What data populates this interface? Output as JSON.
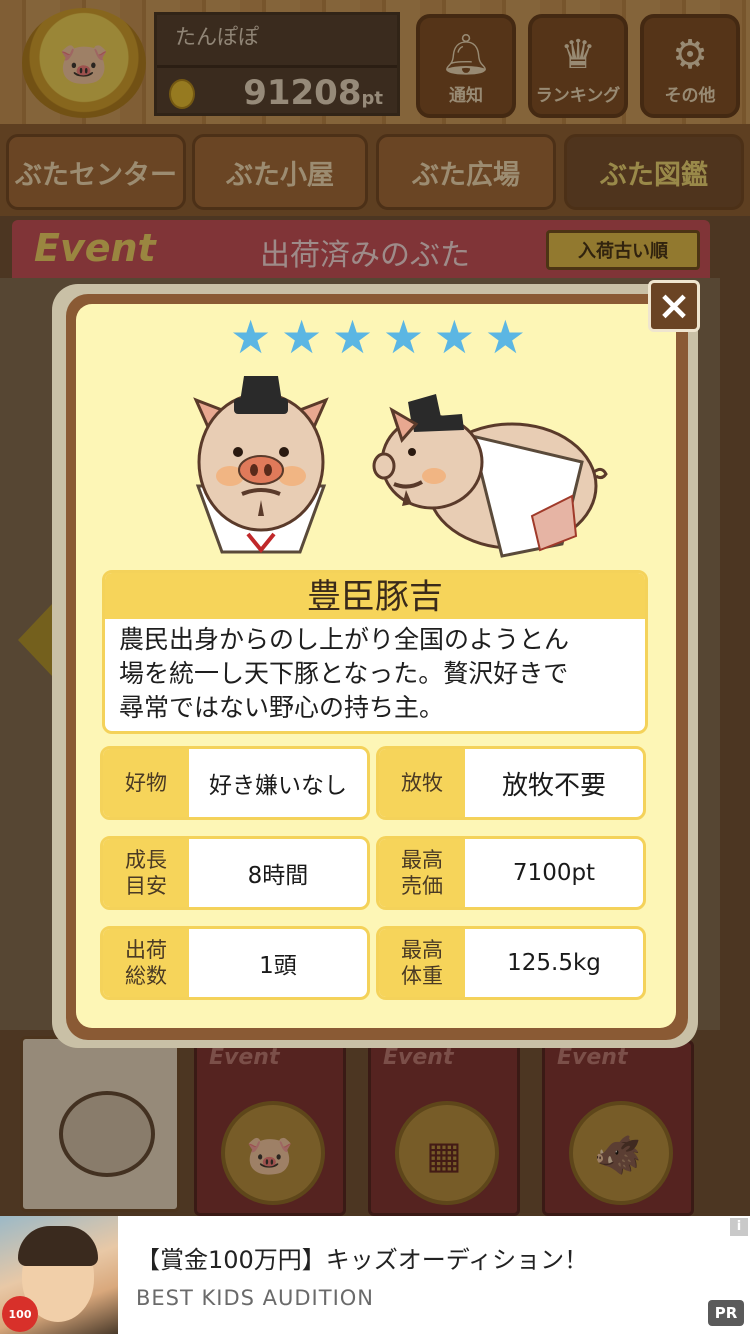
{
  "header": {
    "user_name": "たんぽぽ",
    "points": "91208",
    "points_unit": "pt",
    "buttons": [
      {
        "label": "通知",
        "icon": "bell-icon"
      },
      {
        "label": "ランキング",
        "icon": "crown-icon"
      },
      {
        "label": "その他",
        "icon": "gear-icon"
      }
    ]
  },
  "nav": {
    "tabs": [
      {
        "label": "ぶたセンター",
        "active": false
      },
      {
        "label": "ぶた小屋",
        "active": false
      },
      {
        "label": "ぶた広場",
        "active": false
      },
      {
        "label": "ぶた図鑑",
        "active": true
      }
    ]
  },
  "event_bar": {
    "badge": "Event",
    "title": "出荷済みのぶた",
    "sort_label": "入荷古い順"
  },
  "modal": {
    "close_label": "×",
    "rarity_stars": 6,
    "pig_name": "豊臣豚吉",
    "description_lines": [
      "農民出身からのし上がり全国のようとん",
      "場を統一し天下豚となった。贅沢好きで",
      "尋常ではない野心の持ち主。"
    ],
    "stats": {
      "favorite": {
        "label": "好物",
        "value": "好き嫌いなし"
      },
      "pasture": {
        "label": "放牧",
        "value": "放牧不要"
      },
      "growth": {
        "label": "成長\n目安",
        "value": "8時間"
      },
      "max_price": {
        "label": "最高\n売価",
        "value": "7100pt"
      },
      "shipped": {
        "label": "出荷\n総数",
        "value": "1頭"
      },
      "max_weight": {
        "label": "最高\n体重",
        "value": "125.5kg"
      }
    }
  },
  "cards": {
    "event_label": "Event"
  },
  "ad": {
    "title": "【賞金100万円】キッズオーディション！",
    "subtitle": "BEST KIDS AUDITION",
    "badge_text": "100",
    "info_label": "i",
    "pr_label": "PR"
  },
  "colors": {
    "accent_yellow": "#f6d45a",
    "star_blue": "#5bb6e3",
    "modal_bg": "#fdf6b6",
    "event_red": "#c84a5a"
  }
}
